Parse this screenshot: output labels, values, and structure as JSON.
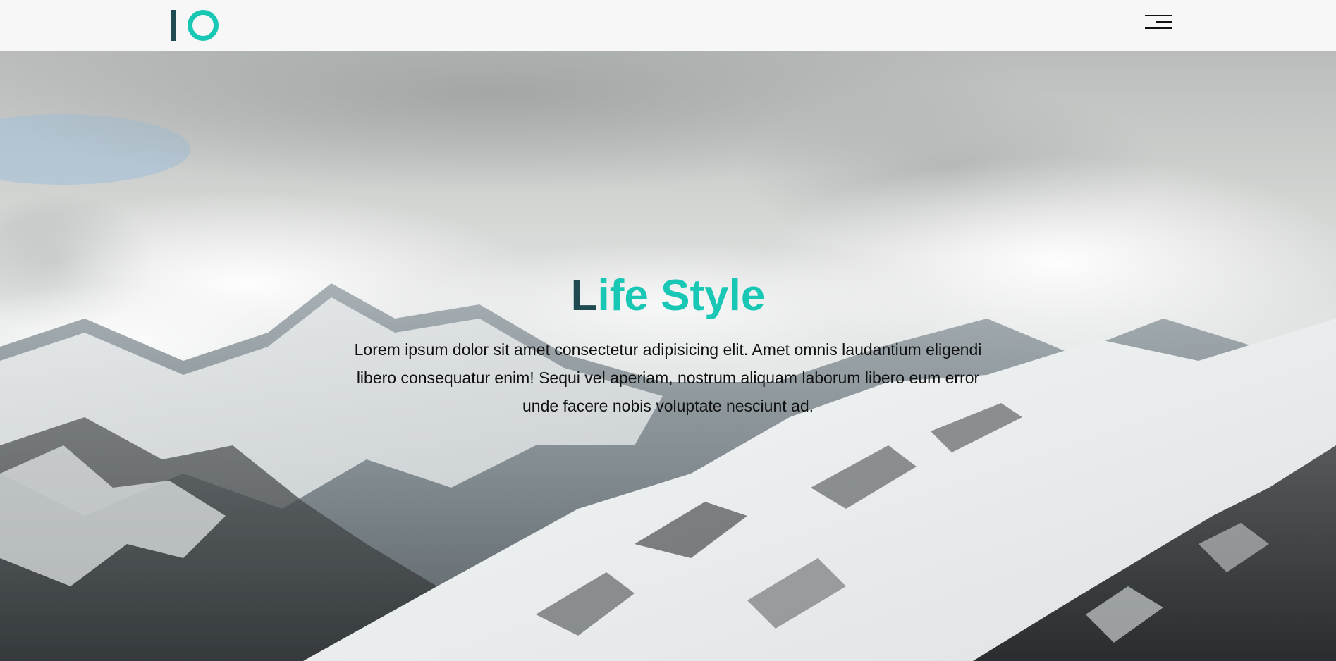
{
  "header": {
    "logo": {
      "text": "IO",
      "bar_color": "#1f4a52",
      "ring_color": "#18c7b4"
    },
    "menu_icon": "hamburger-menu-icon"
  },
  "hero": {
    "background": "snowy-mountains-clouds",
    "title_first": "L",
    "title_rest": "ife Style",
    "title_first_color": "#1f4a52",
    "title_accent_color": "#18c7b4",
    "text": "Lorem ipsum dolor sit amet consectetur adipisicing elit. Amet omnis laudantium eligendi libero consequatur enim! Sequi vel aperiam, nostrum aliquam laborum libero eum error unde facere nobis voluptate nesciunt ad."
  }
}
